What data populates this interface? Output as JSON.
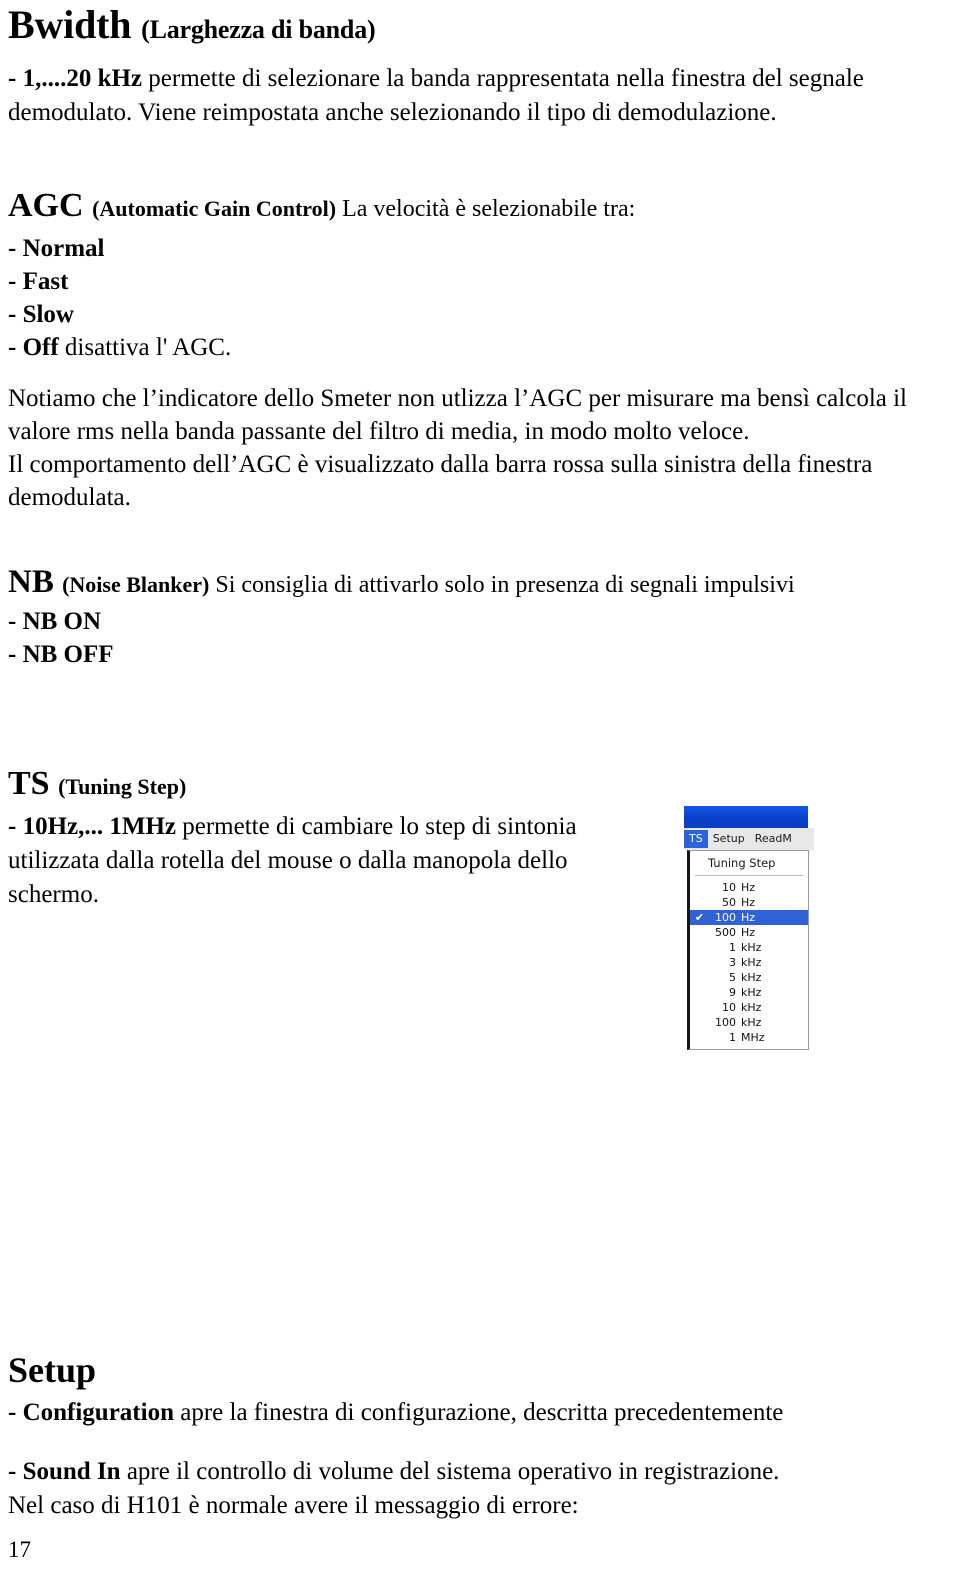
{
  "doc": {
    "page_number": "17",
    "sections": [
      {
        "id": "bwidth",
        "heading_main": "Bwidth",
        "heading_sub": "(Larghezza di banda)",
        "body_bold": "- 1,....20 kHz",
        "body_line1": " permette di selezionare la banda rappresentata nella finestra del segnale",
        "body_line2": "demodulato. Viene reimpostata anche selezionando il tipo di demodulazione."
      },
      {
        "id": "agc",
        "heading_main": "AGC",
        "heading_sub": "(Automatic Gain Control)",
        "heading_tail": " La velocità è selezionabile tra:",
        "options": [
          "- Normal",
          "- Fast",
          "- Slow"
        ],
        "option_off_bold": "- Off",
        "option_off_rest": " disattiva l' AGC.",
        "note_line1": "Notiamo che l’indicatore dello Smeter non utlizza l’AGC per misurare ma bensì calcola il",
        "note_line2": "valore rms nella banda passante del filtro di media, in modo molto veloce.",
        "note_line3": "Il comportamento dell’AGC è visualizzato dalla barra rossa sulla sinistra della finestra",
        "note_line4": "demodulata."
      },
      {
        "id": "nb",
        "heading_main": "NB",
        "heading_sub": "(Noise Blanker)",
        "heading_tail": "  Si consiglia di attivarlo solo in presenza di segnali impulsivi",
        "options": [
          "- NB ON",
          "- NB OFF"
        ]
      },
      {
        "id": "ts",
        "heading_main": "TS",
        "heading_sub": "(Tuning Step)",
        "body_bold": "- 10Hz,... 1MHz",
        "body_line1": "  permette di cambiare lo step di sintonia",
        "body_line2": "utilizzata dalla rotella del mouse o dalla manopola dello",
        "body_line3": "schermo."
      },
      {
        "id": "setup",
        "heading_main": "Setup",
        "item1_bold": "- Configuration",
        "item1_rest": " apre la finestra di configurazione, descritta precedentemente",
        "item2_bold": "- Sound In",
        "item2_rest": " apre il controllo di volume del sistema operativo in registrazione.",
        "item2_line2": "Nel caso di H101 è normale avere il messaggio di errore:"
      }
    ]
  },
  "screenshot": {
    "menubar": [
      {
        "label": "TS",
        "active": true
      },
      {
        "label": "Setup",
        "active": false
      },
      {
        "label": "ReadM",
        "active": false
      }
    ],
    "dropdown": {
      "header": "Tuning Step",
      "items": [
        {
          "value": "10",
          "unit": "Hz",
          "selected": false,
          "check": ""
        },
        {
          "value": "50",
          "unit": "Hz",
          "selected": false,
          "check": ""
        },
        {
          "value": "100",
          "unit": "Hz",
          "selected": true,
          "check": "✔"
        },
        {
          "value": "500",
          "unit": "Hz",
          "selected": false,
          "check": ""
        },
        {
          "value": "1",
          "unit": "kHz",
          "selected": false,
          "check": ""
        },
        {
          "value": "3",
          "unit": "kHz",
          "selected": false,
          "check": ""
        },
        {
          "value": "5",
          "unit": "kHz",
          "selected": false,
          "check": ""
        },
        {
          "value": "9",
          "unit": "kHz",
          "selected": false,
          "check": ""
        },
        {
          "value": "10",
          "unit": "kHz",
          "selected": false,
          "check": ""
        },
        {
          "value": "100",
          "unit": "kHz",
          "selected": false,
          "check": ""
        },
        {
          "value": "1",
          "unit": "MHz",
          "selected": false,
          "check": ""
        }
      ]
    },
    "colors": {
      "titlebar": "#0a3fc8",
      "menu_active": "#2d63d8",
      "item_selected": "#2f62d6",
      "menubar_bg": "#e8e8e8"
    }
  }
}
